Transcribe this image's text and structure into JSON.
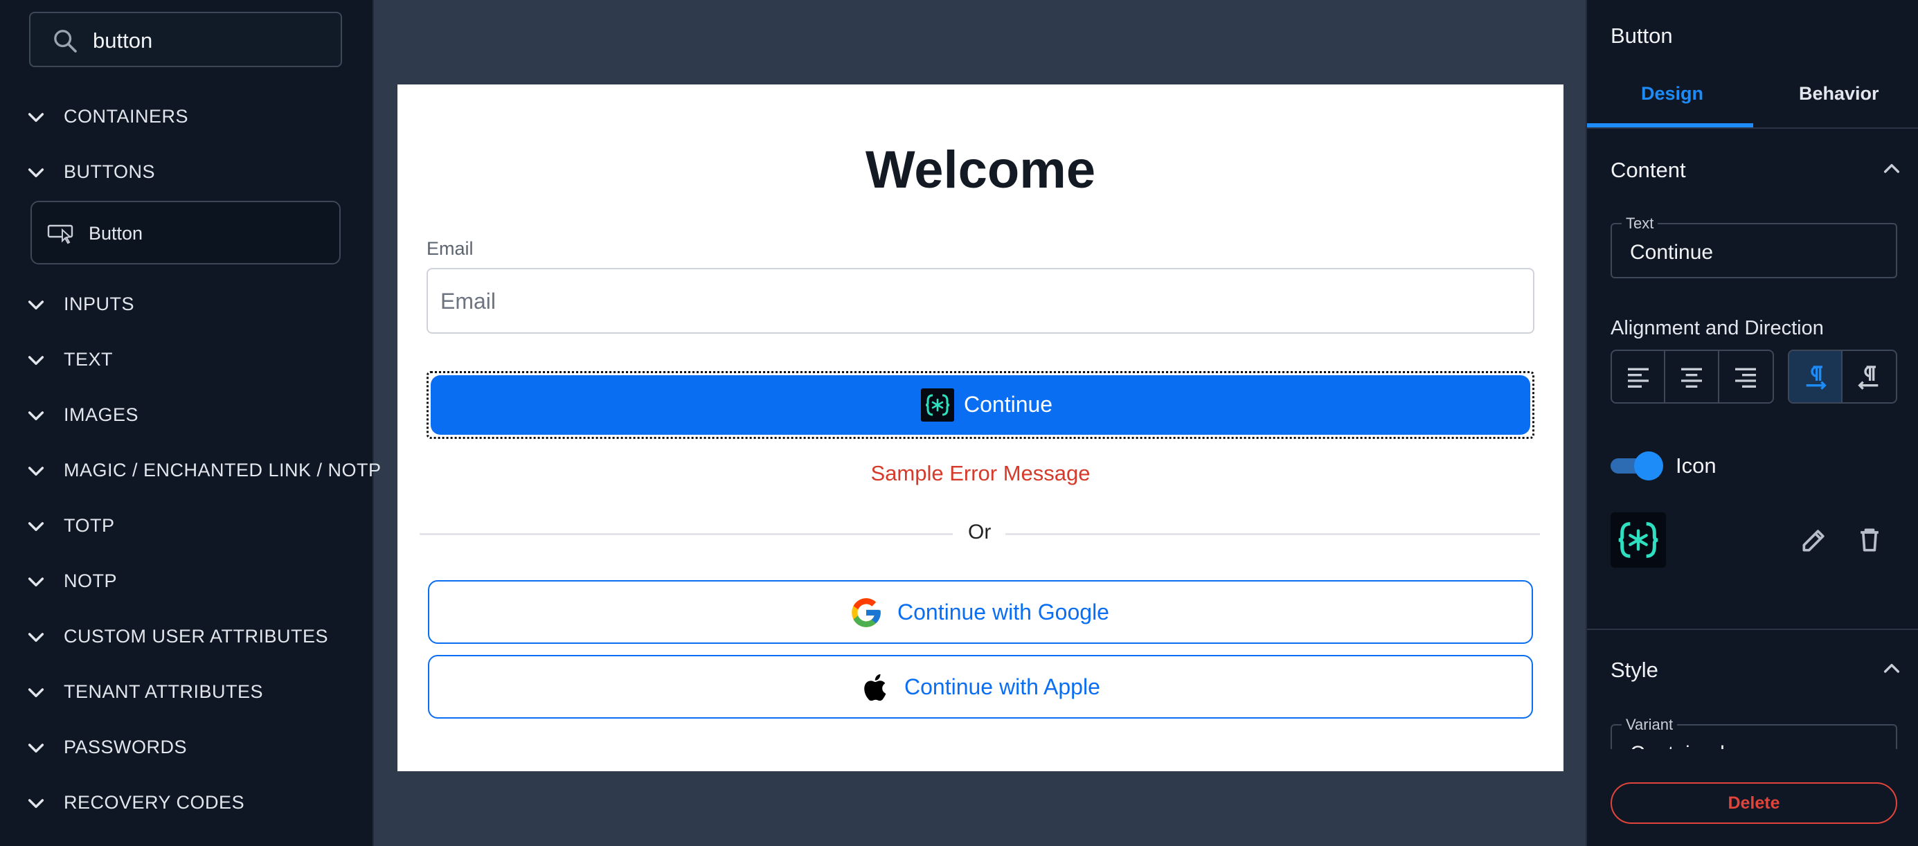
{
  "sidebar": {
    "search": {
      "value": "button"
    },
    "categories": [
      "CONTAINERS",
      "BUTTONS",
      "INPUTS",
      "TEXT",
      "IMAGES",
      "MAGIC / ENCHANTED LINK / NOTP",
      "TOTP",
      "NOTP",
      "CUSTOM USER ATTRIBUTES",
      "TENANT ATTRIBUTES",
      "PASSWORDS",
      "RECOVERY CODES"
    ],
    "component_item": {
      "label": "Button",
      "icon": "button-component-icon"
    }
  },
  "canvas": {
    "title": "Welcome",
    "email_label": "Email",
    "email_placeholder": "Email",
    "primary_button": "Continue",
    "error": "Sample Error Message",
    "divider_text": "Or",
    "google_button": "Continue with Google",
    "apple_button": "Continue with Apple"
  },
  "panel": {
    "title": "Button",
    "tabs": [
      "Design",
      "Behavior"
    ],
    "active_tab": "Design",
    "content_section": "Content",
    "text_field_label": "Text",
    "text_field_value": "Continue",
    "alignment_label": "Alignment and Direction",
    "icon_toggle_label": "Icon",
    "icon_toggle_on": true,
    "style_section": "Style",
    "variant_label": "Variant",
    "variant_value": "Contained",
    "delete_label": "Delete"
  },
  "colors": {
    "accent": "#1d8cf8",
    "primary_button": "#0a6ef3",
    "error": "#d53a2a",
    "delete": "#e0443b"
  }
}
